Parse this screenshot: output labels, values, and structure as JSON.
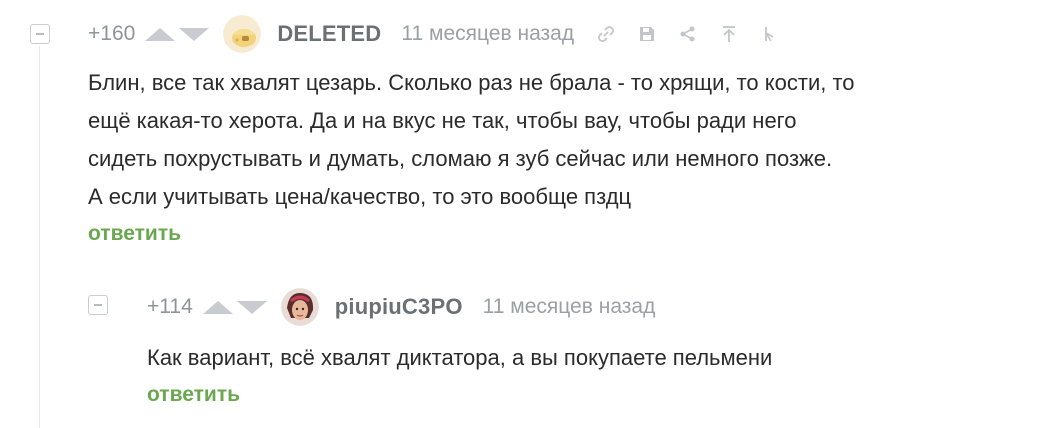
{
  "comments": [
    {
      "rating": "+160",
      "username": "DELETED",
      "time": "11 месяцев назад",
      "text_lines": [
        "Блин, все так хвалят цезарь. Сколько раз не брала - то хрящи, то кости, то",
        "ещё какая-то херота. Да и на вкус не так, чтобы вау, чтобы ради него",
        "сидеть похрустывать и думать, сломаю я зуб сейчас или немного позже.",
        "А если учитывать цена/качество, то это вообще пздц"
      ],
      "reply_label": "ответить",
      "tool_icons": [
        "link-icon",
        "save-icon",
        "share-icon",
        "scroll-up-icon",
        "more-icon"
      ]
    },
    {
      "rating": "+114",
      "username": "piupiuC3PO",
      "time": "11 месяцев назад",
      "text_lines": [
        "Как вариант, всё хвалят диктатора, а вы покупаете пельмени"
      ],
      "reply_label": "ответить"
    }
  ],
  "colors": {
    "reply": "#6aa84f",
    "meta": "#9aa0a6",
    "arrow": "#c8ccd0"
  }
}
